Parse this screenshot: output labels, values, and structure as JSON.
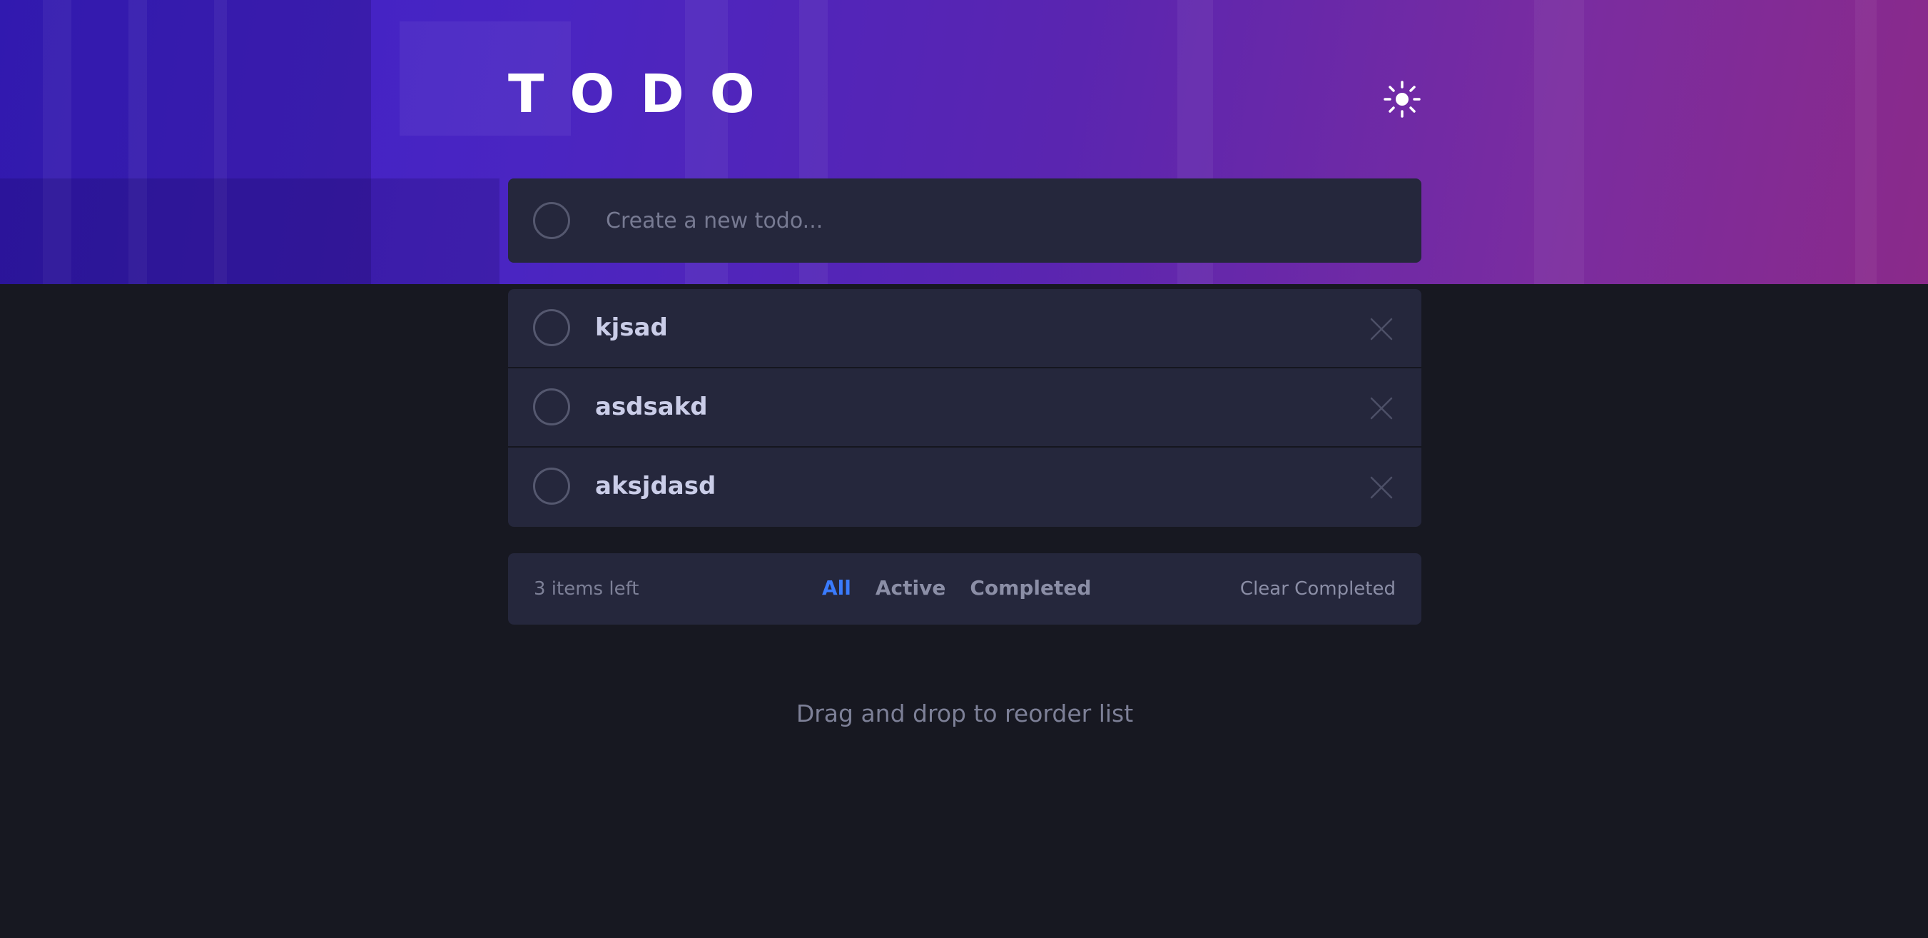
{
  "header": {
    "title": "TODO",
    "theme_icon": "sun-icon"
  },
  "new_todo": {
    "placeholder": "Create a new todo..."
  },
  "todos": [
    {
      "text": "kjsad",
      "completed": false
    },
    {
      "text": "asdsakd",
      "completed": false
    },
    {
      "text": "aksjdasd",
      "completed": false
    }
  ],
  "footer": {
    "items_left": "3 items left",
    "filters": [
      "All",
      "Active",
      "Completed"
    ],
    "active_filter": "All",
    "clear_label": "Clear Completed"
  },
  "hint": "Drag and drop to reorder list",
  "colors": {
    "background": "#171821",
    "card": "#25273c",
    "accent": "#3a7bfd",
    "gradient_start": "#3a1fc8",
    "gradient_end": "#8a2a8a"
  }
}
